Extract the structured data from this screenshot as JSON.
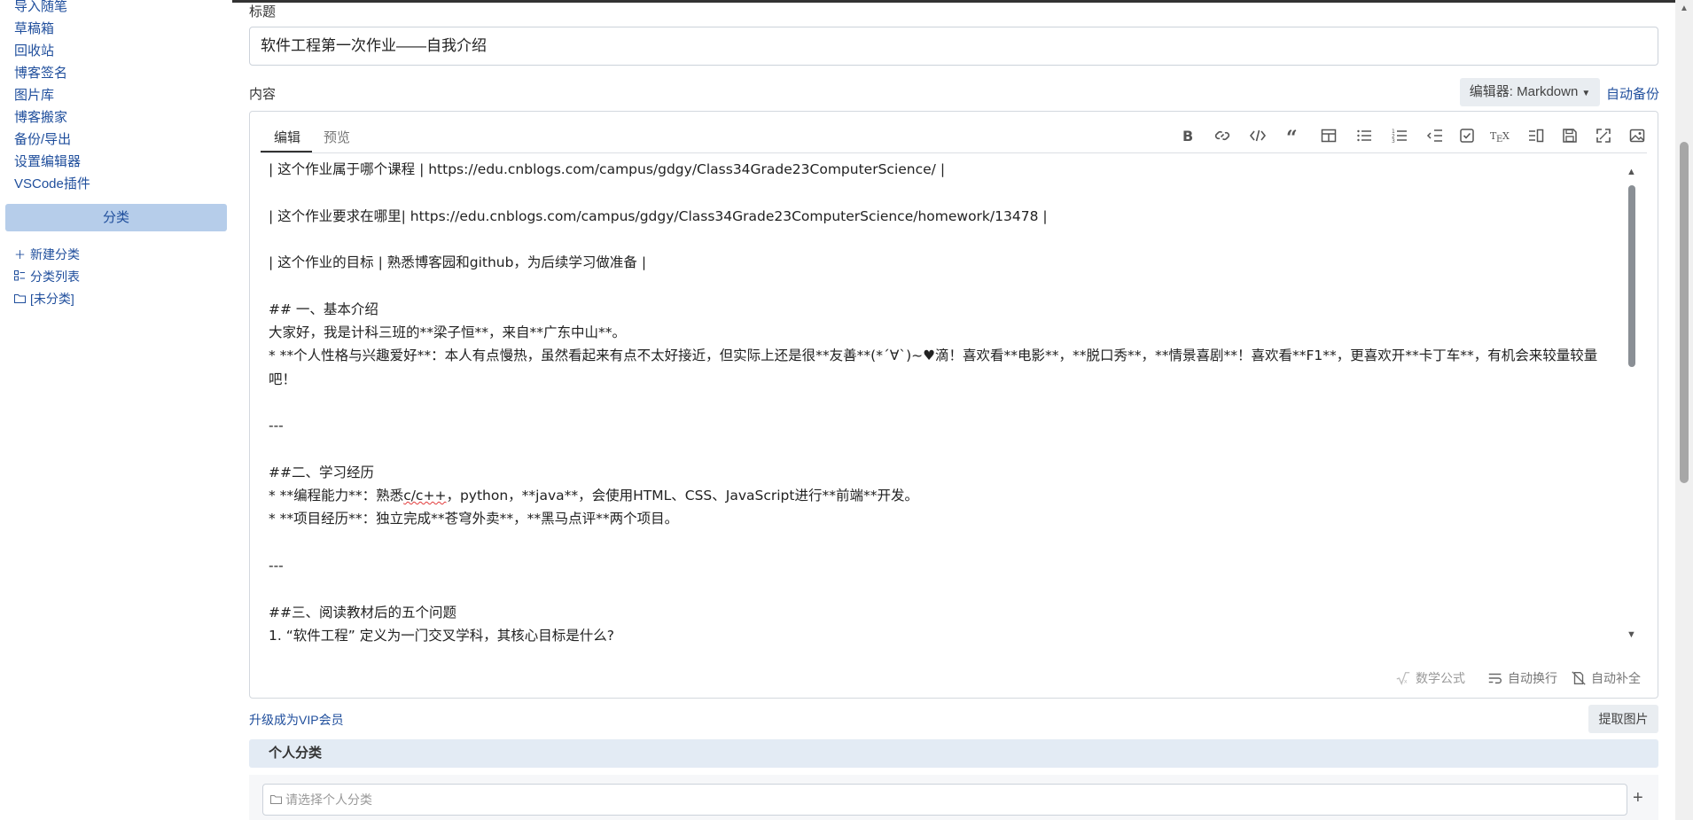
{
  "sidebar": {
    "links": [
      "导入随笔",
      "草稿箱",
      "回收站",
      "博客签名",
      "图片库",
      "博客搬家",
      "备份/导出",
      "设置编辑器",
      "VSCode插件"
    ],
    "category_header": "分类",
    "category_links": [
      {
        "icon": "plus-icon",
        "label": "新建分类"
      },
      {
        "icon": "list-icon",
        "label": "分类列表"
      },
      {
        "icon": "folder-icon",
        "label": "[未分类]"
      }
    ]
  },
  "form": {
    "title_label": "标题",
    "title_value": "软件工程第一次作业——自我介绍",
    "content_label": "内容",
    "editor_select": "编辑器: Markdown",
    "autosave": "自动备份"
  },
  "editor": {
    "tabs": [
      "编辑",
      "预览"
    ],
    "active_tab": "编辑",
    "toolbar": [
      "bold-icon",
      "link-icon",
      "code-icon",
      "quote-icon",
      "table-icon",
      "unordered-list-icon",
      "ordered-list-icon",
      "outdent-icon",
      "checkbox-icon",
      "tex-icon",
      "columns-icon",
      "save-icon",
      "fullscreen-icon",
      "image-icon"
    ],
    "lines": [
      "| 这个作业属于哪个课程 | https://edu.cnblogs.com/campus/gdgy/Class34Grade23ComputerScience/ |",
      "",
      "| 这个作业要求在哪里| https://edu.cnblogs.com/campus/gdgy/Class34Grade23ComputerScience/homework/13478 |",
      "",
      "| 这个作业的目标 | 熟悉博客园和github，为后续学习做准备 |",
      "",
      "## 一、基本介绍",
      "大家好，我是计科三班的**梁子恒**，来自**广东中山**。",
      "* **个人性格与兴趣爱好**：本人有点慢热，虽然看起来有点不太好接近，但实际上还是很**友善**(*´∀`)~♥滴！喜欢看**电影**，**脱口秀**，**情景喜剧**！喜欢看**F1**，更喜欢开**卡丁车**，有机会来较量较量吧！",
      "",
      "---",
      "",
      "##二、学习经历",
      "* **编程能力**：熟悉c/c++，python，**java**，会使用HTML、CSS、JavaScript进行**前端**开发。",
      "* **项目经历**：独立完成**苍穹外卖**，**黑马点评**两个项目。",
      "",
      "---",
      "",
      "##三、阅读教材后的五个问题",
      "1. “软件工程” 定义为一门交叉学科，其核心目标是什么?"
    ],
    "status": [
      "数学公式",
      "自动换行",
      "自动补全"
    ]
  },
  "footer": {
    "vip_link": "升级成为VIP会员",
    "fetch_images": "提取图片",
    "personal_category": "个人分类",
    "category_placeholder": "请选择个人分类",
    "add": "+"
  }
}
